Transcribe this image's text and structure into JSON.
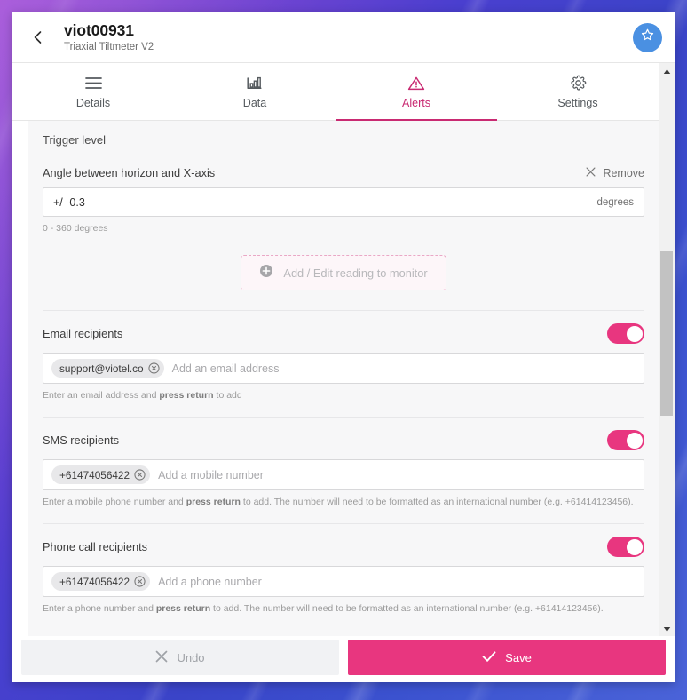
{
  "window": {
    "header": {
      "back_icon": "chevron-left-icon",
      "title": "viot00931",
      "subtitle": "Triaxial Tiltmeter V2",
      "favorite_icon": "star-icon"
    },
    "tabs": [
      {
        "label": "Details",
        "icon": "list-icon",
        "active": false
      },
      {
        "label": "Data",
        "icon": "bar-chart-icon",
        "active": false
      },
      {
        "label": "Alerts",
        "icon": "warning-triangle-icon",
        "active": true
      },
      {
        "label": "Settings",
        "icon": "gear-icon",
        "active": false
      }
    ],
    "content": {
      "trigger_section_label": "Trigger level",
      "reading": {
        "title": "Angle between horizon and X-axis",
        "remove_label": "Remove",
        "remove_icon": "close-x-icon",
        "value": "+/- 0.3",
        "unit": "degrees",
        "helper": "0 - 360 degrees"
      },
      "add_reading": {
        "label": "Add / Edit reading to monitor",
        "icon": "plus-circle-icon"
      },
      "email_recipients": {
        "title": "Email recipients",
        "enabled": true,
        "chips": [
          "support@viotel.co"
        ],
        "placeholder": "Add an email address",
        "helper_prefix": "Enter an email address and ",
        "helper_bold": "press return",
        "helper_suffix": " to add"
      },
      "sms_recipients": {
        "title": "SMS recipients",
        "enabled": true,
        "chips": [
          "+61474056422"
        ],
        "placeholder": "Add a mobile number",
        "helper_prefix": "Enter a mobile phone number and ",
        "helper_bold": "press return",
        "helper_suffix": " to add. The number will need to be formatted as an international number (e.g. +61414123456)."
      },
      "phone_recipients": {
        "title": "Phone call recipients",
        "enabled": true,
        "chips": [
          "+61474056422"
        ],
        "placeholder": "Add a phone number",
        "helper_prefix": "Enter a phone number and ",
        "helper_bold": "press return",
        "helper_suffix": " to add. The number will need to be formatted as an international number (e.g. +61414123456)."
      }
    },
    "footer": {
      "undo_label": "Undo",
      "undo_icon": "close-x-icon",
      "save_label": "Save",
      "save_icon": "check-icon"
    },
    "colors": {
      "accent_pink": "#e8367f",
      "tab_active": "#c92a72",
      "favorite_blue": "#4a90e2"
    }
  }
}
